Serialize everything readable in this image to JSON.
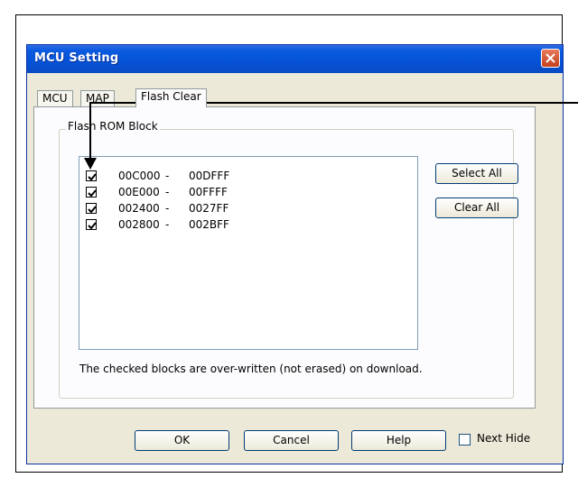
{
  "dialog": {
    "title": "MCU Setting"
  },
  "tabs": [
    {
      "label": "MCU",
      "active": false
    },
    {
      "label": "MAP",
      "active": false
    },
    {
      "label": "Flash Clear",
      "active": true
    }
  ],
  "flash_group": {
    "label": "Flash ROM Block",
    "blocks": [
      {
        "start": "00C000",
        "separator": "-",
        "end": "00DFFF",
        "checked": true
      },
      {
        "start": "00E000",
        "separator": "-",
        "end": "00FFFF",
        "checked": true
      },
      {
        "start": "002400",
        "separator": "-",
        "end": "0027FF",
        "checked": true
      },
      {
        "start": "002800",
        "separator": "-",
        "end": "002BFF",
        "checked": true
      }
    ],
    "select_all_label": "Select All",
    "clear_all_label": "Clear All",
    "note": "The checked blocks are over-written (not erased) on download."
  },
  "footer": {
    "ok_label": "OK",
    "cancel_label": "Cancel",
    "help_label": "Help",
    "next_hide_label": "Next Hide",
    "next_hide_checked": false
  },
  "colors": {
    "titlebar": "#0552d6",
    "dialog_bg": "#ece9d8",
    "close_button": "#c4401d"
  }
}
